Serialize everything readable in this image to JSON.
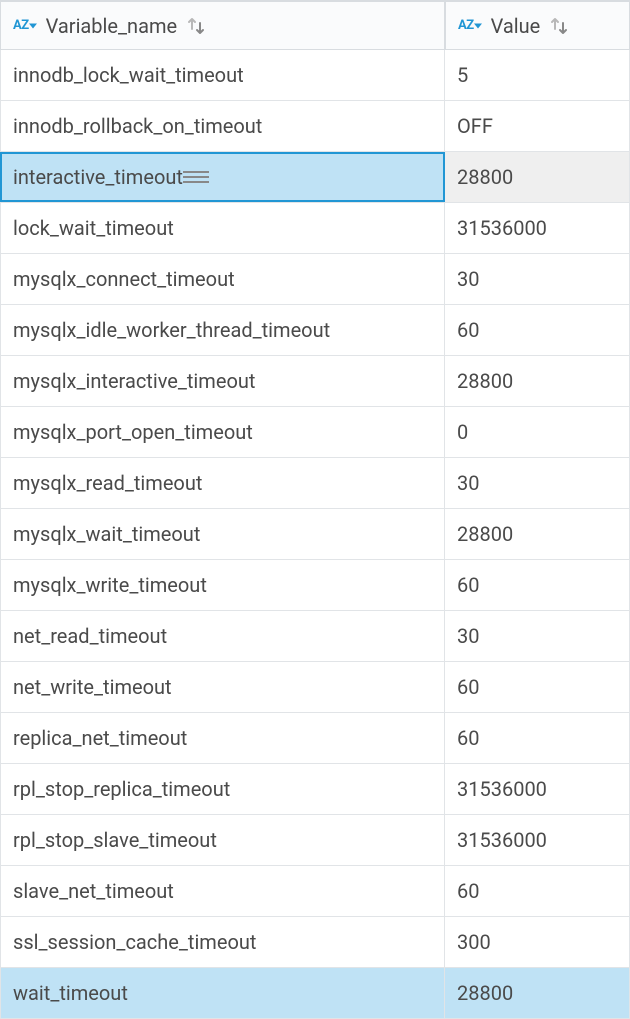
{
  "columns": {
    "name_label": "Variable_name",
    "value_label": "Value"
  },
  "rows": [
    {
      "name": "innodb_lock_wait_timeout",
      "value": "5",
      "state": ""
    },
    {
      "name": "innodb_rollback_on_timeout",
      "value": "OFF",
      "state": ""
    },
    {
      "name": "interactive_timeout",
      "value": "28800",
      "state": "selected-focus"
    },
    {
      "name": "lock_wait_timeout",
      "value": "31536000",
      "state": ""
    },
    {
      "name": "mysqlx_connect_timeout",
      "value": "30",
      "state": ""
    },
    {
      "name": "mysqlx_idle_worker_thread_timeout",
      "value": "60",
      "state": ""
    },
    {
      "name": "mysqlx_interactive_timeout",
      "value": "28800",
      "state": ""
    },
    {
      "name": "mysqlx_port_open_timeout",
      "value": "0",
      "state": ""
    },
    {
      "name": "mysqlx_read_timeout",
      "value": "30",
      "state": ""
    },
    {
      "name": "mysqlx_wait_timeout",
      "value": "28800",
      "state": ""
    },
    {
      "name": "mysqlx_write_timeout",
      "value": "60",
      "state": ""
    },
    {
      "name": "net_read_timeout",
      "value": "30",
      "state": ""
    },
    {
      "name": "net_write_timeout",
      "value": "60",
      "state": ""
    },
    {
      "name": "replica_net_timeout",
      "value": "60",
      "state": ""
    },
    {
      "name": "rpl_stop_replica_timeout",
      "value": "31536000",
      "state": ""
    },
    {
      "name": "rpl_stop_slave_timeout",
      "value": "31536000",
      "state": ""
    },
    {
      "name": "slave_net_timeout",
      "value": "60",
      "state": ""
    },
    {
      "name": "ssl_session_cache_timeout",
      "value": "300",
      "state": ""
    },
    {
      "name": "wait_timeout",
      "value": "28800",
      "state": "selected-row"
    }
  ]
}
